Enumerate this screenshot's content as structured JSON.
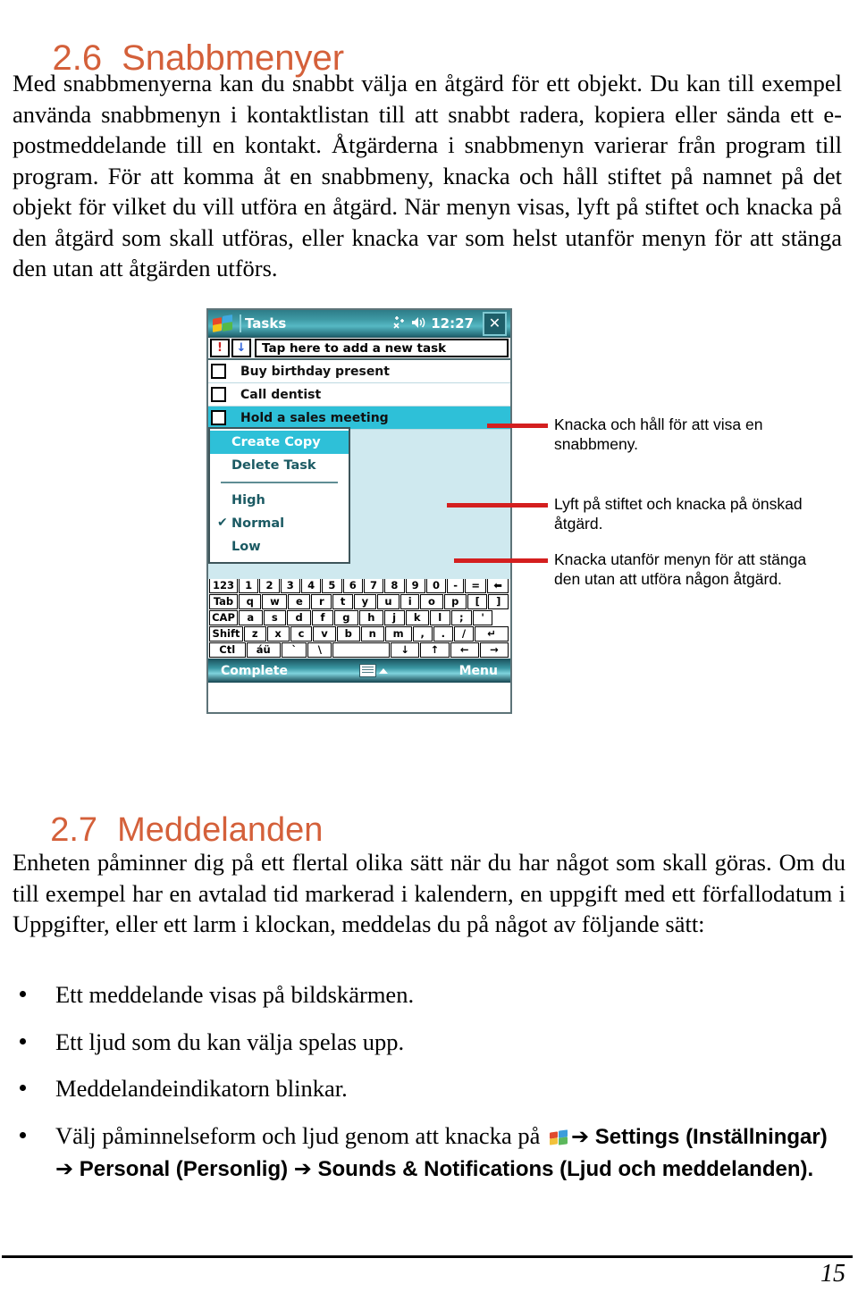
{
  "document": {
    "page_number": "15"
  },
  "section_26": {
    "number": "2.6",
    "title": "Snabbmenyer",
    "paragraph": "Med snabbmenyerna kan du snabbt välja en åtgärd för ett objekt. Du kan till exempel använda snabbmenyn i kontaktlistan till att snabbt radera, kopiera eller sända ett e-postmeddelande till en kontakt. Åtgärderna i snabbmenyn varierar från program till program. För att komma åt en snabbmeny, knacka och håll stiftet på namnet på det objekt för vilket du vill utföra en åtgärd. När menyn visas, lyft på stiftet och knacka på den åtgärd som skall utföras, eller knacka var som helst utanför menyn för att stänga den utan att åtgärden utförs."
  },
  "figure": {
    "pda": {
      "titlebar": {
        "start_logo": "windows-logo-icon",
        "title": "Tasks",
        "connectivity_icon": "connectivity-icon",
        "volume_icon": "speaker-icon",
        "clock": "12:27",
        "close_label": "✕"
      },
      "toolbar": {
        "priority_button": "!",
        "sort_button": "↓",
        "new_task_placeholder": "Tap here to add a new task"
      },
      "tasks": [
        {
          "name": "Buy birthday present",
          "selected": false
        },
        {
          "name": "Call dentist",
          "selected": false
        },
        {
          "name": "Hold a sales meeting",
          "selected": true
        }
      ],
      "context_menu": {
        "items": [
          {
            "label": "Create Copy",
            "highlighted": true,
            "checked": false
          },
          {
            "label": "Delete Task",
            "highlighted": false,
            "checked": false
          },
          {
            "separator": true
          },
          {
            "label": "High",
            "highlighted": false,
            "checked": false
          },
          {
            "label": "Normal",
            "highlighted": false,
            "checked": true
          },
          {
            "label": "Low",
            "highlighted": false,
            "checked": false
          }
        ],
        "check_glyph": "✔"
      },
      "keyboard": {
        "rows": [
          [
            "123",
            "1",
            "2",
            "3",
            "4",
            "5",
            "6",
            "7",
            "8",
            "9",
            "0",
            "-",
            "=",
            "⬅"
          ],
          [
            "Tab",
            "q",
            "w",
            "e",
            "r",
            "t",
            "y",
            "u",
            "i",
            "o",
            "p",
            "[",
            "]"
          ],
          [
            "CAP",
            "a",
            "s",
            "d",
            "f",
            "g",
            "h",
            "j",
            "k",
            "l",
            ";",
            "'",
            ""
          ],
          [
            "Shift",
            "z",
            "x",
            "c",
            "v",
            "b",
            "n",
            "m",
            ",",
            ".",
            "/",
            "↵"
          ],
          [
            "Ctl",
            "áü",
            "`",
            "\\",
            "",
            "↓",
            "↑",
            "←",
            "→"
          ]
        ]
      },
      "bottombar": {
        "left_label": "Complete",
        "sip_icon": "keyboard-icon",
        "right_label": "Menu"
      }
    },
    "callouts": [
      "Knacka och håll för att visa en snabbmeny.",
      "Lyft på stiftet och knacka på önskad åtgärd.",
      "Knacka utanför menyn för att stänga den utan att utföra någon åtgärd."
    ],
    "leader_color": "#d41f1f"
  },
  "section_27": {
    "number": "2.7",
    "title": "Meddelanden",
    "paragraph": "Enheten påminner dig på ett flertal olika sätt när du har något som skall göras. Om du till exempel har en avtalad tid markerad i kalendern, en uppgift med ett förfallodatum i Uppgifter, eller ett larm i klockan, meddelas du på något av följande sätt:",
    "bullets": [
      {
        "text": "Ett meddelande visas på bildskärmen."
      },
      {
        "text": "Ett ljud som du kan välja spelas upp."
      },
      {
        "text": "Meddelandeindikatorn blinkar."
      }
    ],
    "last_bullet": {
      "lead": "Välj påminnelseform och ljud genom att knacka på ",
      "icon": "windows-start-icon",
      "arrow": "➔",
      "path_1": "Settings (Inställningar)",
      "path_2": "Personal (Personlig)",
      "path_3": "Sounds & Notifications (Ljud och meddelanden)",
      "period": "."
    }
  },
  "colors": {
    "heading": "#d4603a",
    "leader": "#d41f1f",
    "pda_accent": "#2ec0d8"
  }
}
